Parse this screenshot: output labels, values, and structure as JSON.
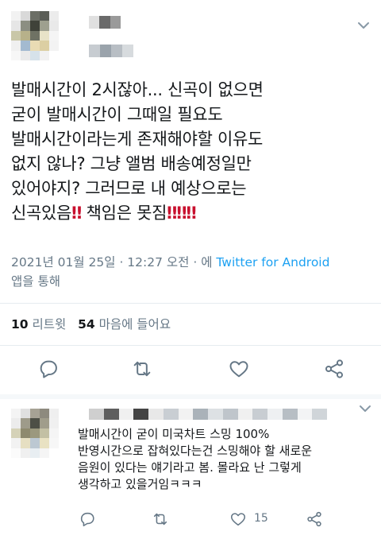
{
  "tweet": {
    "text_lines": [
      "발매시간이 2시잖아... 신곡이 없으면",
      "굳이 발매시간이 그때일 필요도",
      "발매시간이라는게 존재해야할 이유도",
      "없지 않나? 그냥 앨범 배송예정일만",
      "있어야지? 그러므로 내 예상으로는"
    ],
    "last_line_a": "신곡있음",
    "last_line_b": "책임은 못짐",
    "bang": "‼",
    "timestamp": "2021년 01월 25일 · 12:27 오전 · 에",
    "app_name": "Twitter for Android",
    "via_suffix": "앱을 통해",
    "retweets_count": "10",
    "retweets_label": "리트윗",
    "likes_count": "54",
    "likes_label": "마음에 들어요"
  },
  "reply": {
    "text": "발매시간이 굳이 미국차트 스밍 100%\n반영시간으로 잡혀있다는건 스밍해야 할 새로운\n음원이 있다는 얘기라고 봄. 몰라요 난 그렇게\n생각하고 있을거임ㅋㅋㅋ",
    "like_count": "15"
  },
  "icons": {
    "caret": "chevron-down-icon",
    "reply": "reply-icon",
    "retweet": "retweet-icon",
    "like": "heart-icon",
    "share": "share-icon"
  },
  "colors": {
    "link": "#1da1f2",
    "meta": "#657786",
    "text": "#14171a",
    "bang": "#c8102e"
  }
}
